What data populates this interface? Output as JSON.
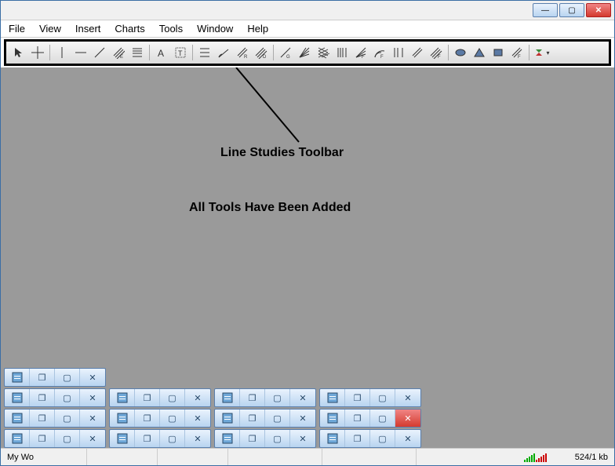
{
  "titlebar": {
    "minimize": "—",
    "maximize": "▢",
    "close": "✕"
  },
  "menu": {
    "items": [
      "File",
      "View",
      "Insert",
      "Charts",
      "Tools",
      "Window",
      "Help"
    ]
  },
  "toolbar": {
    "tools": [
      "cursor",
      "crosshair",
      "vertical-line",
      "horizontal-line",
      "trendline",
      "equidistant-channel",
      "fibonacci-retracement",
      "text",
      "text-label",
      "expand-channel",
      "trend-by-angle",
      "linear-regression",
      "standard-deviation",
      "gann-line",
      "gann-fan",
      "gann-grid",
      "fibo-channel",
      "fibo-fan",
      "fibo-arc",
      "fibo-expansion",
      "fibo-time-zones",
      "andrews-pitchfork",
      "cycle-lines",
      "ellipse",
      "triangle",
      "rectangle",
      "fibo-zone",
      "arrows"
    ]
  },
  "annotation": {
    "label1": "Line Studies Toolbar",
    "label2": "All Tools Have Been Added"
  },
  "childwindows": {
    "rows": [
      {
        "count": 1,
        "activeClose": -1
      },
      {
        "count": 4,
        "activeClose": -1
      },
      {
        "count": 4,
        "activeClose": 3
      },
      {
        "count": 4,
        "activeClose": -1
      }
    ]
  },
  "statusbar": {
    "left": "My Wo",
    "traffic": "524/1 kb"
  }
}
